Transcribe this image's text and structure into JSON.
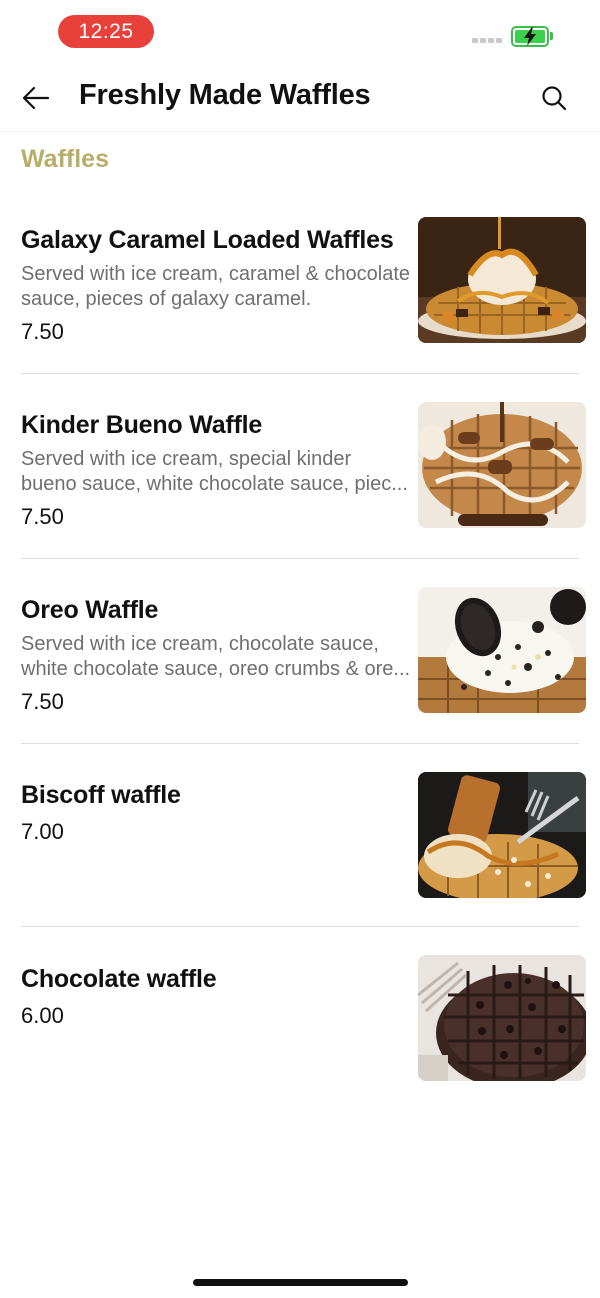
{
  "status_bar": {
    "time": "12:25",
    "battery_color": "#3bd04d",
    "time_pill_color": "#e8413b"
  },
  "header": {
    "title": "Freshly Made Waffles",
    "back_icon": "arrow-left-icon",
    "search_icon": "search-icon"
  },
  "section": {
    "title": "Waffles",
    "accent_color": "#b9ad6a"
  },
  "items": [
    {
      "name": "Galaxy Caramel Loaded Waffles",
      "description_lines": [
        "Served with ice cream, caramel & chocolate",
        "sauce, pieces of galaxy caramel."
      ],
      "price": "7.50",
      "image": "galaxy-caramel-waffle-photo"
    },
    {
      "name": "Kinder Bueno Waffle",
      "description_lines": [
        "Served with ice cream, special kinder",
        "bueno sauce, white chocolate sauce, piec..."
      ],
      "price": "7.50",
      "image": "kinder-bueno-waffle-photo"
    },
    {
      "name": "Oreo Waffle",
      "description_lines": [
        "Served with ice cream, chocolate sauce,",
        "white chocolate sauce, oreo crumbs & ore..."
      ],
      "price": "7.50",
      "image": "oreo-waffle-photo"
    },
    {
      "name": "Biscoff waffle",
      "description_lines": [],
      "price": "7.00",
      "image": "biscoff-waffle-photo"
    },
    {
      "name": "Chocolate waffle",
      "description_lines": [],
      "price": "6.00",
      "image": "chocolate-waffle-photo"
    }
  ]
}
